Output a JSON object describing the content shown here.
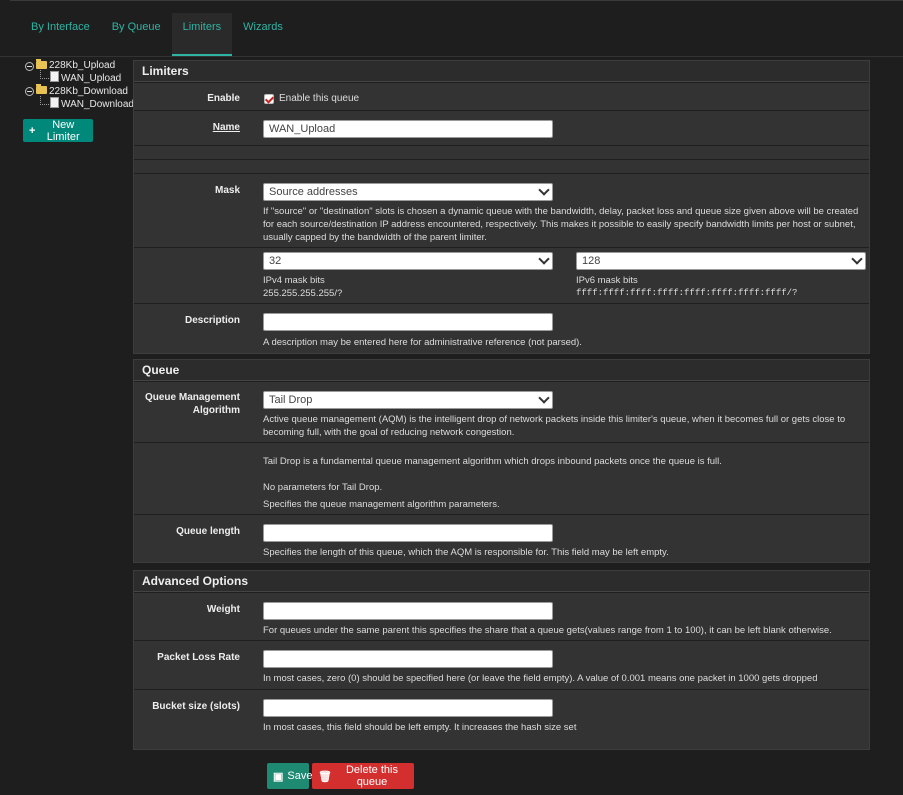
{
  "tabs": [
    {
      "label": "By Interface"
    },
    {
      "label": "By Queue"
    },
    {
      "label": "Limiters"
    },
    {
      "label": "Wizards"
    }
  ],
  "tree": {
    "nodes": [
      {
        "label": "228Kb_Upload"
      },
      {
        "label": "WAN_Upload"
      },
      {
        "label": "228Kb_Download"
      },
      {
        "label": "WAN_Download"
      }
    ]
  },
  "new_limiter_label": "New Limiter",
  "limiters": {
    "title": "Limiters",
    "enable_label": "Enable",
    "enable_checkbox_label": "Enable this queue",
    "name_label": "Name",
    "name_value": "WAN_Upload",
    "mask_label": "Mask",
    "mask_value": "Source addresses",
    "mask_help": "If \"source\" or \"destination\" slots is chosen a dynamic queue with the bandwidth, delay, packet loss and queue size given above will be created for each source/destination IP address encountered, respectively. This makes it possible to easily specify bandwidth limits per host or subnet, usually capped by the bandwidth of the parent limiter.",
    "ipv4_value": "32",
    "ipv4_help": "IPv4 mask bits",
    "ipv4_mask": "255.255.255.255/?",
    "ipv6_value": "128",
    "ipv6_help": "IPv6 mask bits",
    "ipv6_mask": "ffff:ffff:ffff:ffff:ffff:ffff:ffff:ffff/?",
    "description_label": "Description",
    "description_value": "",
    "description_help": "A description may be entered here for administrative reference (not parsed)."
  },
  "queue": {
    "title": "Queue",
    "qma_label_1": "Queue Management",
    "qma_label_2": "Algorithm",
    "qma_value": "Tail Drop",
    "qma_help": "Active queue management (AQM) is the intelligent drop of network packets inside this limiter's queue, when it becomes full or gets close to becoming full, with the goal of reducing network congestion.",
    "taildrop_info": "Tail Drop is a fundamental queue management algorithm which drops inbound packets once the queue is full.",
    "no_params": "No parameters for Tail Drop.",
    "params_help": "Specifies the queue management algorithm parameters.",
    "length_label": "Queue length",
    "length_value": "",
    "length_help": "Specifies the length of this queue, which the AQM is responsible for. This field may be left empty."
  },
  "advanced": {
    "title": "Advanced Options",
    "weight_label": "Weight",
    "weight_value": "",
    "weight_help": "For queues under the same parent this specifies the share that a queue gets(values range from 1 to 100), it can be left blank otherwise.",
    "plr_label": "Packet Loss Rate",
    "plr_value": "",
    "plr_help": "In most cases, zero (0) should be specified here (or leave the field empty). A value of 0.001 means one packet in 1000 gets dropped",
    "bucket_label": "Bucket size (slots)",
    "bucket_value": "",
    "bucket_help": "In most cases, this field should be left empty. It increases the hash size set"
  },
  "buttons": {
    "save": "Save",
    "delete": "Delete this queue"
  }
}
